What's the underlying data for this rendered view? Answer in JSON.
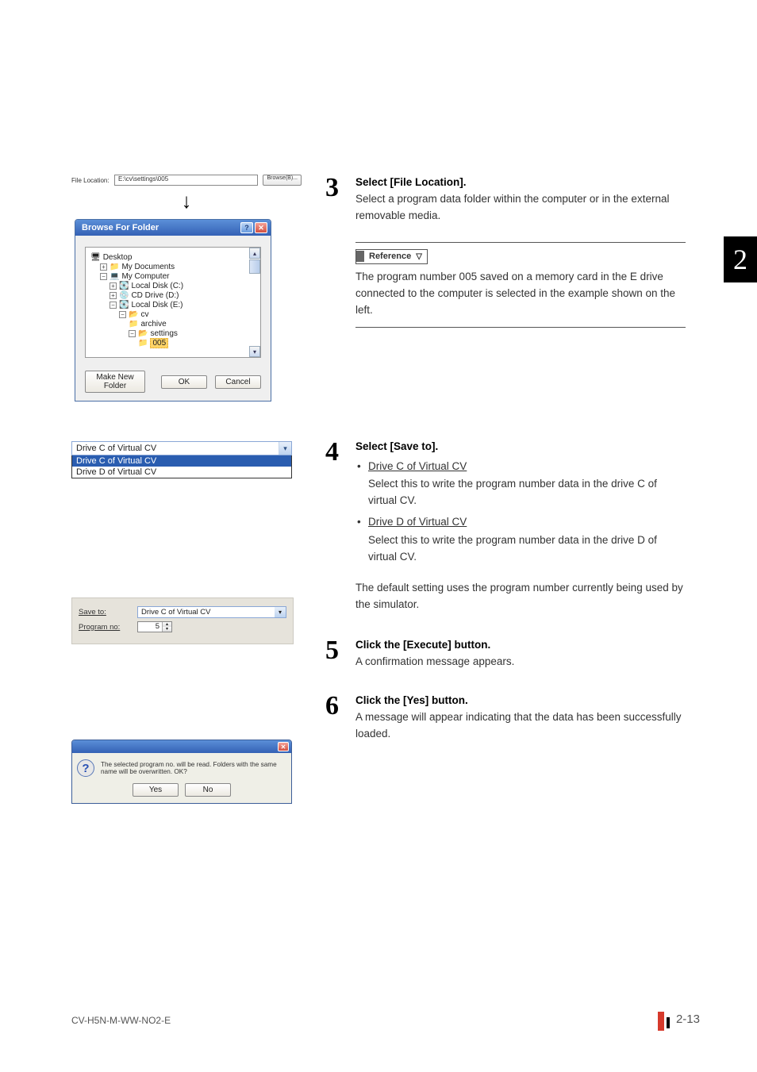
{
  "tab_marker": "2",
  "step3": {
    "title": "Select [File Location].",
    "text": "Select a program data folder within the computer or in the external removable media.",
    "reference_label": "Reference",
    "reference_text": "The program number 005 saved on a memory card in the E drive connected to the computer is selected in the example shown on the left."
  },
  "step4": {
    "title": "Select [Save to].",
    "opt1_label": "Drive C of Virtual CV",
    "opt1_text": "Select this to write the program number data in the drive C of virtual CV.",
    "opt2_label": "Drive D of Virtual CV",
    "opt2_text": "Select this to write the program number data in the drive D of virtual CV.",
    "default_text": "The default setting uses the program number currently being used by the simulator."
  },
  "step5": {
    "title": "Click the [Execute] button.",
    "text": "A confirmation message appears."
  },
  "step6": {
    "title": "Click the [Yes] button.",
    "text": "A message will appear indicating that the data has been successfully loaded."
  },
  "file_location": {
    "label": "File Location:",
    "value": "E:\\cv\\settings\\005",
    "button": "Browse(B)..."
  },
  "browse_window": {
    "title": "Browse For Folder",
    "tree": {
      "desktop": "Desktop",
      "my_documents": "My Documents",
      "my_computer": "My Computer",
      "local_c": "Local Disk (C:)",
      "cd_d": "CD Drive (D:)",
      "local_e": "Local Disk (E:)",
      "cv": "cv",
      "archive": "archive",
      "settings": "settings",
      "selected": "005"
    },
    "make_new": "Make New Folder",
    "ok": "OK",
    "cancel": "Cancel"
  },
  "dropdown": {
    "selected": "Drive C of Virtual CV",
    "opt1": "Drive C of Virtual CV",
    "opt2": "Drive D of Virtual CV"
  },
  "save_panel": {
    "save_to_label": "Save to:",
    "save_to_value": "Drive C of Virtual CV",
    "program_no_label": "Program no:",
    "program_no_value": "5"
  },
  "confirm": {
    "message": "The selected program no. will be read. Folders with the same name will be overwritten. OK?",
    "yes": "Yes",
    "no": "No"
  },
  "footer": {
    "doc_id": "CV-H5N-M-WW-NO2-E",
    "page": "2-13"
  }
}
